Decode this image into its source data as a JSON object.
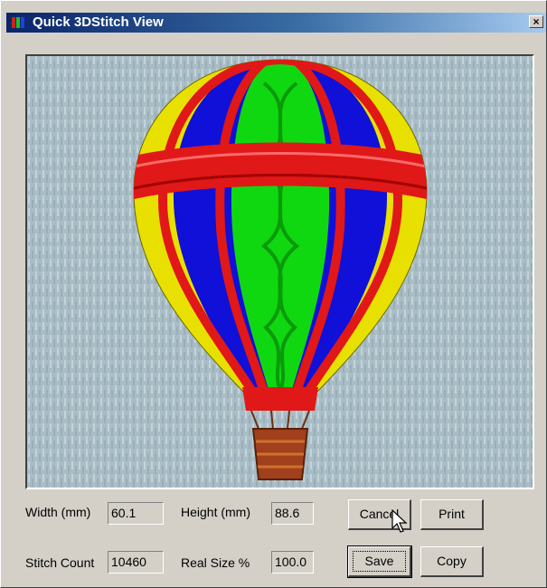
{
  "window": {
    "title": "Quick 3DStitch View",
    "close_label": "×"
  },
  "icons": {
    "title_icon": "embroidery-app-icon",
    "close": "close-icon",
    "cursor": "arrow-cursor-icon"
  },
  "colors": {
    "titlebar_start": "#0a246a",
    "titlebar_end": "#a6caf0",
    "fabric_background": "#a9bdc6",
    "balloon_yellow": "#e8e000",
    "balloon_blue": "#1010d8",
    "balloon_green": "#10d810",
    "balloon_red": "#e01818",
    "basket_brown": "#a0401c"
  },
  "preview": {
    "content": "hot-air-balloon-embroidery"
  },
  "fields": {
    "width_label": "Width (mm)",
    "width_value": "60.1",
    "height_label": "Height (mm)",
    "height_value": "88.6",
    "stitch_count_label": "Stitch Count",
    "stitch_count_value": "10460",
    "real_size_label": "Real Size %",
    "real_size_value": "100.0"
  },
  "buttons": {
    "cancel": "Cancel",
    "print": "Print",
    "save": "Save",
    "copy": "Copy"
  }
}
